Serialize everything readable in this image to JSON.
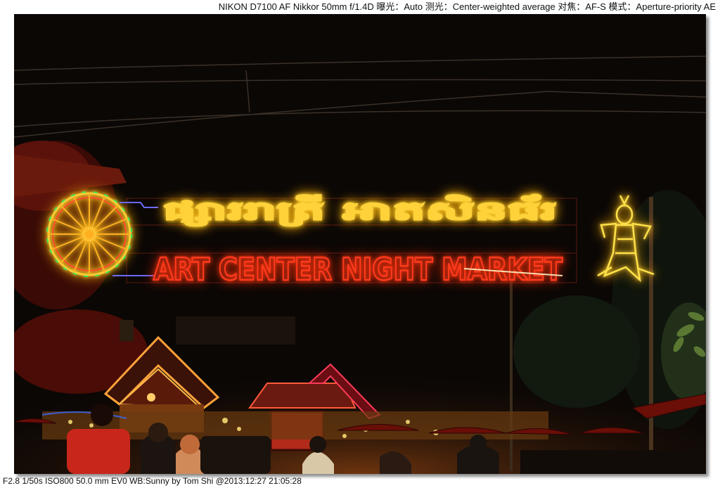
{
  "exif": {
    "top": "NIKON D7100 AF Nikkor 50mm f/1.4D  曝光：Auto  测光：Center-weighted average  对焦：AF-S  模式：Aperture-priority AE",
    "bottom": "F2.8  1/50s  ISO800  50.0 mm  EV0  WB:Sunny  by Tom Shi  @2013:12:27 21:05:28"
  },
  "sign": {
    "english": "ART CENTER NIGHT MARKET",
    "khmer": "ផ្សាររាត្រី អាតសិនធ័រ"
  },
  "colors": {
    "neon_red": "#ff3a1c",
    "neon_yellow": "#ffd43a",
    "sky": "#0b0705"
  }
}
